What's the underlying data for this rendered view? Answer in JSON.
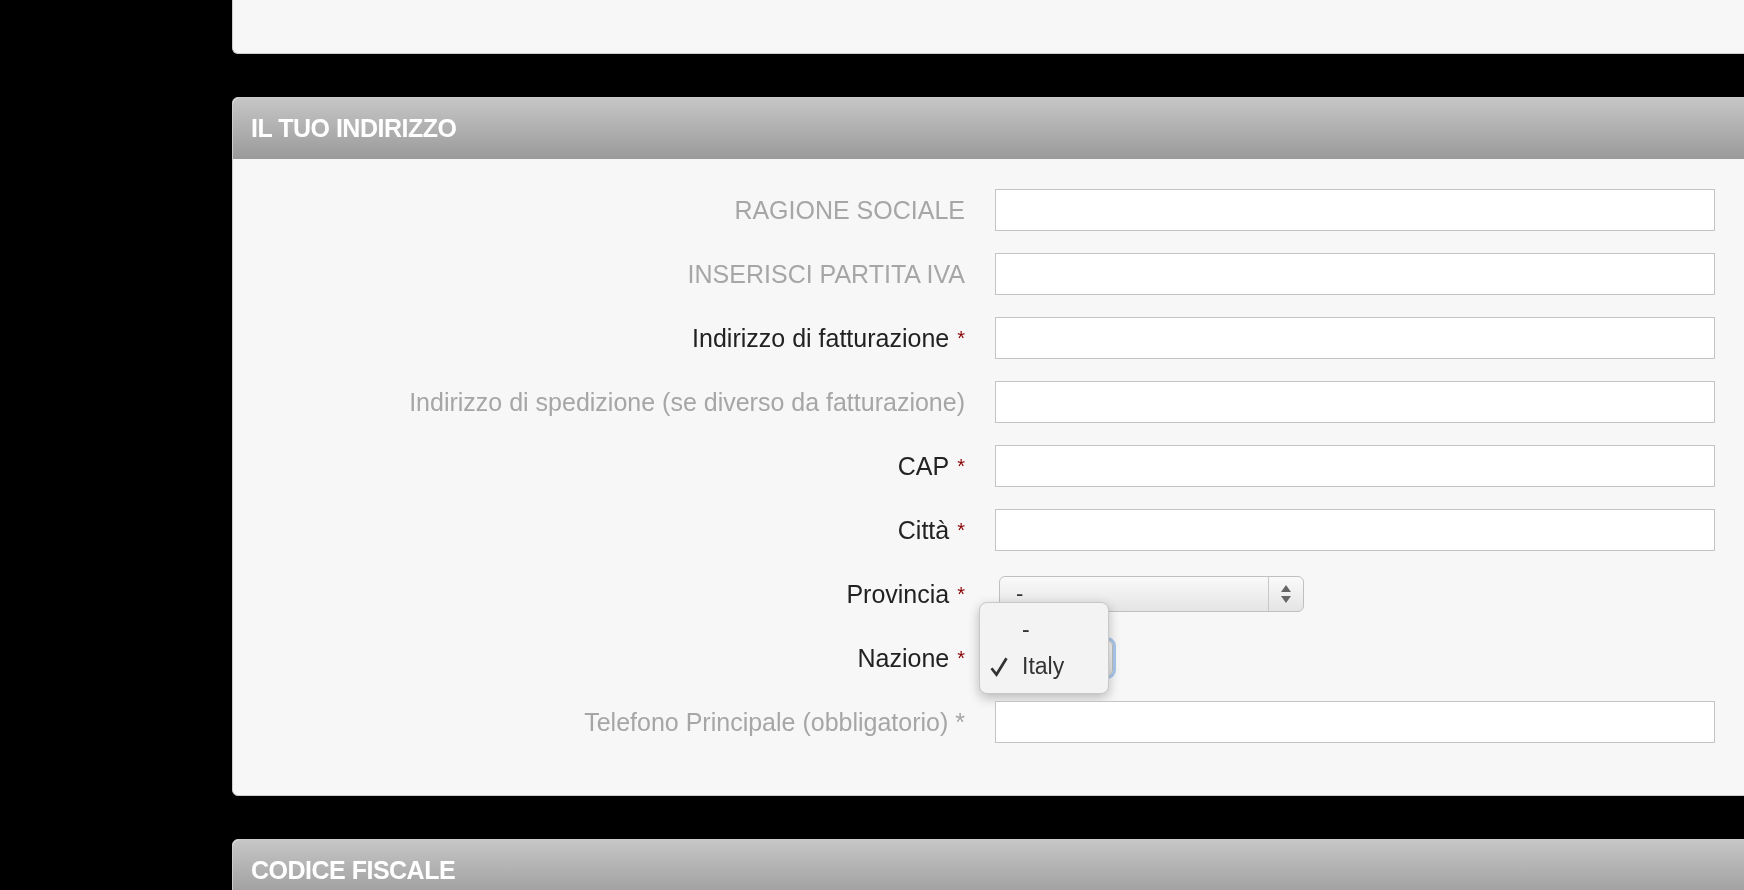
{
  "sections": [
    {
      "title": "IL TUO INDIRIZZO",
      "fields": [
        {
          "label": "RAGIONE SOCIALE",
          "muted": true,
          "kind": "text"
        },
        {
          "label": "INSERISCI PARTITA IVA",
          "muted": true,
          "kind": "text"
        },
        {
          "label": "Indirizzo di fatturazione",
          "asterisk": "*",
          "muted": false,
          "kind": "text"
        },
        {
          "label": "Indirizzo di spedizione (se diverso da fatturazione)",
          "muted": true,
          "kind": "text"
        },
        {
          "label": "CAP",
          "asterisk": "*",
          "muted": false,
          "kind": "text"
        },
        {
          "label": "Città",
          "asterisk": "*",
          "muted": false,
          "kind": "text"
        },
        {
          "label": "Provincia",
          "asterisk": "*",
          "muted": false,
          "kind": "select",
          "value": "-",
          "open": false
        },
        {
          "label": "Nazione",
          "asterisk": "*",
          "muted": false,
          "kind": "select",
          "open": true,
          "options": [
            {
              "label": "-",
              "selected": false
            },
            {
              "label": "Italy",
              "selected": true
            }
          ]
        },
        {
          "label": "Telefono Principale (obbligatorio) *",
          "muted": true,
          "kind": "text"
        }
      ]
    },
    {
      "title": "CODICE FISCALE"
    }
  ]
}
